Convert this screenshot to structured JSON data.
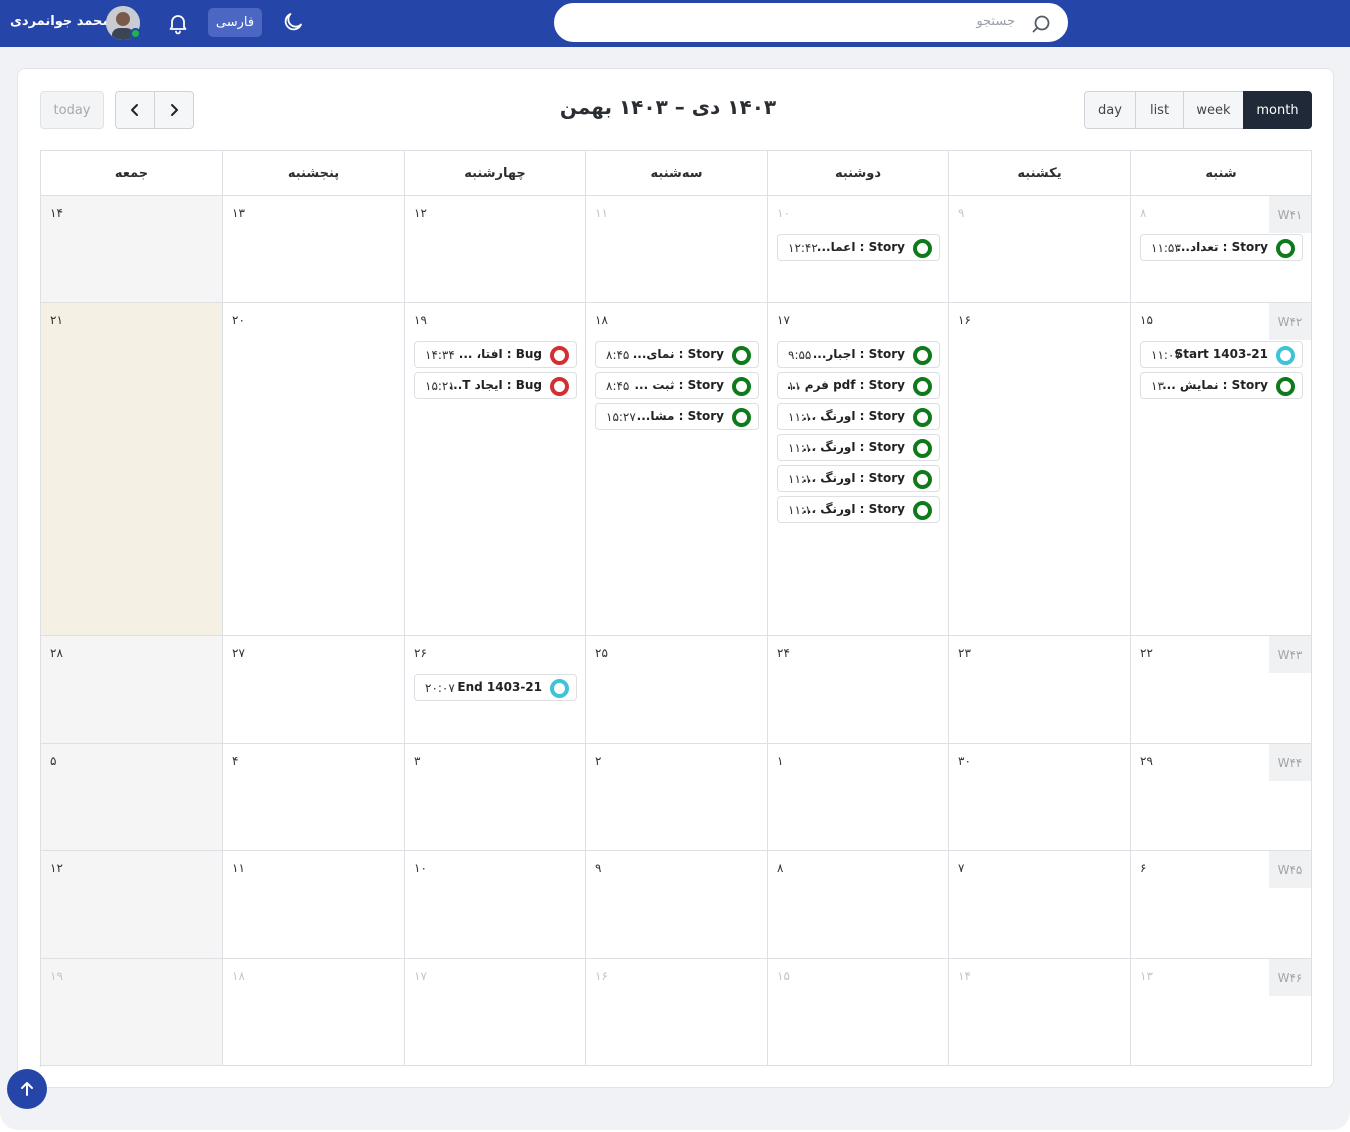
{
  "header": {
    "username": "محمد جوانمردی",
    "language_label": "فارسی",
    "search_placeholder": "جستجو",
    "avatar_status_color": "#22b14c",
    "brand_color": "#2545a8"
  },
  "toolbar": {
    "today_label": "today",
    "title": "۱۴۰۳ دی – ۱۴۰۳ بهمن",
    "views": {
      "day": "day",
      "list": "list",
      "week": "week",
      "month": "month"
    },
    "active_view": "month"
  },
  "calendar": {
    "weekdays": [
      "شنبه",
      "یکشنبه",
      "دوشنبه",
      "سه‌شنبه",
      "چهارشنبه",
      "پنجشنبه",
      "جمعه"
    ],
    "weeks": [
      {
        "label": "W۴۱",
        "days": [
          "۸",
          "۹",
          "۱۰",
          "۱۱",
          "۱۲",
          "۱۳",
          "۱۴"
        ],
        "other_month": [
          true,
          true,
          true,
          true,
          false,
          false,
          false
        ]
      },
      {
        "label": "W۴۲",
        "days": [
          "۱۵",
          "۱۶",
          "۱۷",
          "۱۸",
          "۱۹",
          "۲۰",
          "۲۱"
        ],
        "other_month": [
          false,
          false,
          false,
          false,
          false,
          false,
          false
        ]
      },
      {
        "label": "W۴۳",
        "days": [
          "۲۲",
          "۲۳",
          "۲۴",
          "۲۵",
          "۲۶",
          "۲۷",
          "۲۸"
        ],
        "other_month": [
          false,
          false,
          false,
          false,
          false,
          false,
          false
        ]
      },
      {
        "label": "W۴۴",
        "days": [
          "۲۹",
          "۳۰",
          "۱",
          "۲",
          "۳",
          "۴",
          "۵"
        ],
        "other_month": [
          false,
          false,
          false,
          false,
          false,
          false,
          false
        ]
      },
      {
        "label": "W۴۵",
        "days": [
          "۶",
          "۷",
          "۸",
          "۹",
          "۱۰",
          "۱۱",
          "۱۲"
        ],
        "other_month": [
          false,
          false,
          false,
          false,
          false,
          false,
          false
        ]
      },
      {
        "label": "W۴۶",
        "days": [
          "۱۳",
          "۱۴",
          "۱۵",
          "۱۶",
          "۱۷",
          "۱۸",
          "۱۹"
        ],
        "other_month": [
          true,
          true,
          true,
          true,
          true,
          true,
          true
        ]
      }
    ],
    "today": {
      "week": 1,
      "day": 6
    },
    "events": [
      {
        "week": 0,
        "day": 0,
        "title": "Story : تعداد...",
        "time": "۱۱:۵۳",
        "kind": "story"
      },
      {
        "week": 0,
        "day": 2,
        "title": "Story : اعما...",
        "time": "۱۲:۴۲",
        "kind": "story"
      },
      {
        "week": 1,
        "day": 0,
        "title": "Start 1403-21",
        "time": "۱۱:۰۷",
        "kind": "milestone"
      },
      {
        "week": 1,
        "day": 0,
        "title": "Story : نمایش ...",
        "time": "۱۳",
        "kind": "story"
      },
      {
        "week": 1,
        "day": 2,
        "title": "Story : اجبار...",
        "time": "۹:۵۵",
        "kind": "story"
      },
      {
        "week": 1,
        "day": 2,
        "title": "pdf : Story فرم ...",
        "time": "۱۱",
        "kind": "story"
      },
      {
        "week": 1,
        "day": 2,
        "title": "Story : اورنگ ...",
        "time": "۱۱:۱۰",
        "kind": "story"
      },
      {
        "week": 1,
        "day": 2,
        "title": "Story : اورنگ ...",
        "time": "۱۱:۱۰",
        "kind": "story"
      },
      {
        "week": 1,
        "day": 2,
        "title": "Story : اورنگ ...",
        "time": "۱۱:۱۰",
        "kind": "story"
      },
      {
        "week": 1,
        "day": 2,
        "title": "Story : اورنگ ...",
        "time": "۱۱:۱۰",
        "kind": "story"
      },
      {
        "week": 1,
        "day": 3,
        "title": "Story : نمای...",
        "time": "۸:۴۵",
        "kind": "story"
      },
      {
        "week": 1,
        "day": 3,
        "title": "Story : ثبت ...",
        "time": "۸:۴۵",
        "kind": "story"
      },
      {
        "week": 1,
        "day": 3,
        "title": "Story : مشا...",
        "time": "۱۵:۲۷",
        "kind": "story"
      },
      {
        "week": 1,
        "day": 4,
        "title": "Bug : افتا، ...",
        "time": "۱۴:۳۴",
        "kind": "bug"
      },
      {
        "week": 1,
        "day": 4,
        "title": "Bug : ایجاد T...",
        "time": "۱۵:۲۱",
        "kind": "bug"
      },
      {
        "week": 2,
        "day": 4,
        "title": "End 1403-21",
        "time": "۲۰:۰۷",
        "kind": "milestone"
      }
    ],
    "colors": {
      "story": "#0f7a1c",
      "bug": "#d32f2f",
      "milestone": "#3fc3d6",
      "today_bg": "#f4f1e4",
      "friday_bg": "#f5f5f5"
    }
  }
}
